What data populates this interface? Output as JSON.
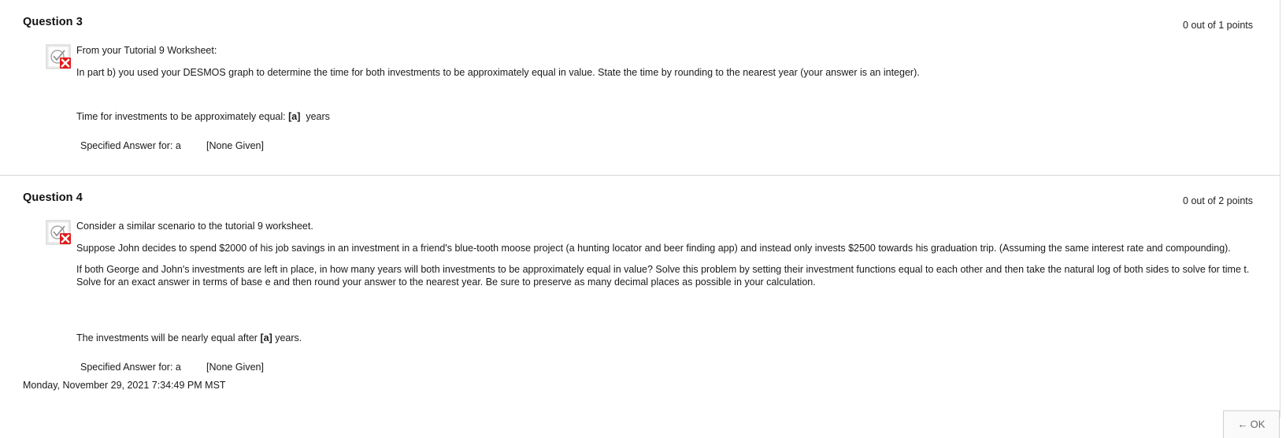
{
  "questions": [
    {
      "title": "Question 3",
      "points": "0 out of 1 points",
      "status_icon": "incorrect-icon",
      "text": [
        "From your Tutorial 9 Worksheet:",
        "In part b) you used your DESMOS graph to determine the time for both investments to be approximately equal in value.  State the time by rounding to the nearest year (your answer is an integer)."
      ],
      "answer_prefix": "Time for investments to be approximately equal: ",
      "answer_blank": "[a]",
      "answer_suffix": "  years",
      "specified_label": "Specified Answer for: a",
      "specified_value": "[None Given]"
    },
    {
      "title": "Question 4",
      "points": "0 out of 2 points",
      "status_icon": "incorrect-icon",
      "text": [
        "Consider a similar scenario to the tutorial 9 worksheet.",
        "Suppose John decides to spend $2000 of his job savings in an investment in a friend's blue-tooth moose project (a hunting locator and beer finding app) and instead only invests $2500 towards his graduation trip. (Assuming the same interest rate and compounding).",
        "If both George and John's investments are left in place, in how many years will both investments to be approximately equal in value? Solve this problem by setting their investment functions equal to each other and then take the natural log of both sides to solve for time t.  Solve for an exact answer in terms of base e and then round your answer to the nearest year.  Be sure to preserve as many decimal places as possible in your calculation."
      ],
      "answer_prefix": "The investments will be nearly equal after ",
      "answer_blank": "[a]",
      "answer_suffix": " years.",
      "specified_label": "Specified Answer for: a",
      "specified_value": "[None Given]"
    }
  ],
  "timestamp": "Monday, November 29, 2021 7:34:49 PM MST",
  "ok_button": {
    "arrow": "←",
    "label": "OK"
  },
  "colors": {
    "incorrect": "#e01b1b",
    "divider": "#d7d7d7"
  }
}
